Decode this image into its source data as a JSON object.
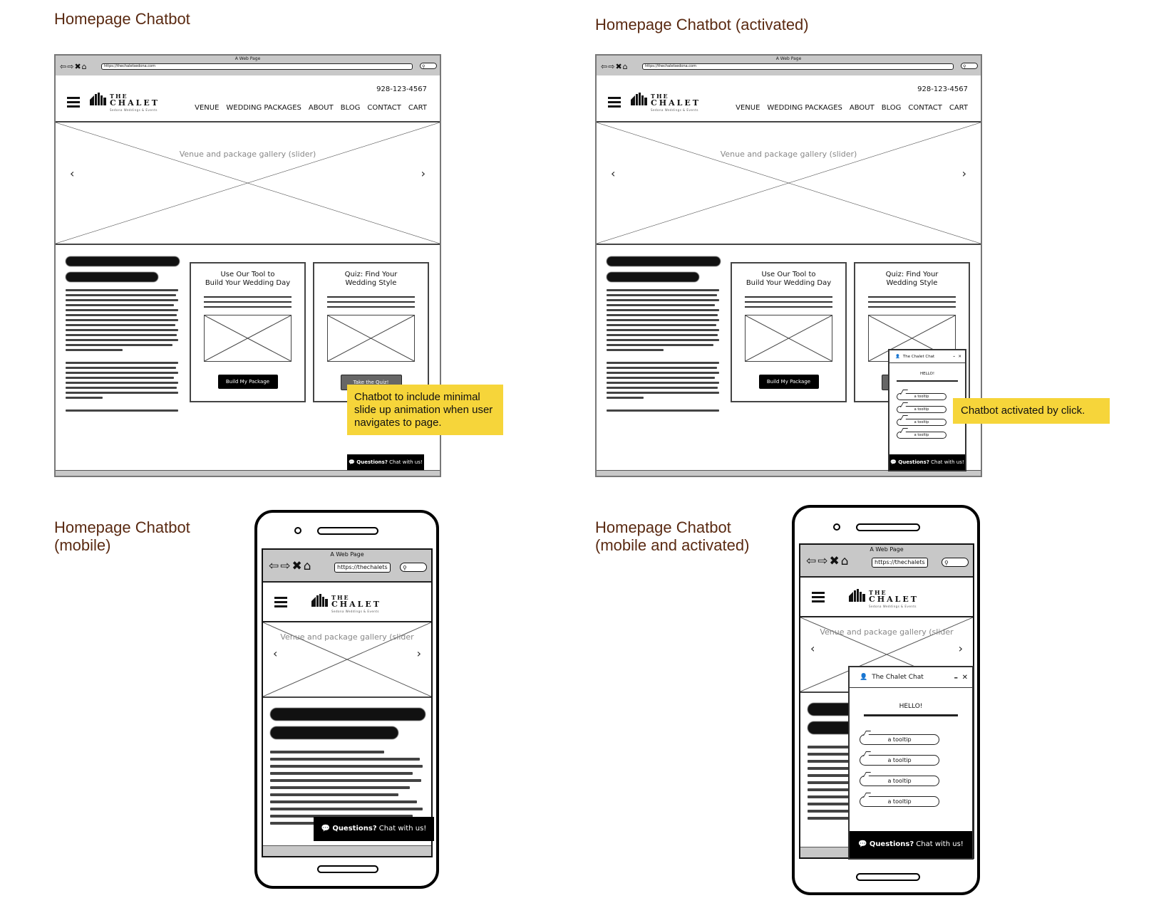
{
  "sections": [
    {
      "id": "desktop",
      "title": "Homepage Chatbot"
    },
    {
      "id": "desktop_activated",
      "title": "Homepage Chatbot (activated)"
    },
    {
      "id": "mobile",
      "title_line1": "Homepage Chatbot",
      "title_line2": "(mobile)"
    },
    {
      "id": "mobile_activated",
      "title_line1": "Homepage Chatbot",
      "title_line2": "(mobile and activated)"
    }
  ],
  "browser": {
    "window_title": "A Web Page",
    "url_desktop": "https://thechaletsedona.com",
    "url_mobile": "https://thechalets",
    "search_glyph": "⚲"
  },
  "site": {
    "logo_the": "THE",
    "logo_chalet": "CHALET",
    "logo_tagline": "Sedona Weddings & Events",
    "phone": "928-123-4567",
    "menu": [
      "VENUE",
      "WEDDING PACKAGES",
      "ABOUT",
      "BLOG",
      "CONTACT",
      "CART"
    ],
    "hero_caption": "Venue and package gallery (slider)",
    "hero_caption_mobile": "Venue and package gallery (slider",
    "prev_glyph": "‹",
    "next_glyph": "›",
    "cards": [
      {
        "title_line1": "Use Our Tool to",
        "title_line2": "Build Your Wedding Day",
        "button": "Build My Package"
      },
      {
        "title_line1": "Quiz: Find Your",
        "title_line2": "Wedding Style",
        "button": "Take the Quiz!"
      }
    ],
    "chat_bar": {
      "bold": "Questions?",
      "rest": " Chat with us!"
    }
  },
  "chatbot": {
    "title": "The Chalet Chat",
    "minimize": "–",
    "close": "✕",
    "greeting": "HELLO!",
    "tooltips": [
      "a tooltip",
      "a tooltip",
      "a tooltip",
      "a tooltip"
    ]
  },
  "notes": {
    "desktop": "Chatbot to include minimal slide up animation when user navigates to page.",
    "activated": "Chatbot activated by click."
  },
  "colors": {
    "section_title": "#5a2a12",
    "note_bg": "#f6d53a",
    "chrome_bg": "#c8c8c8"
  }
}
